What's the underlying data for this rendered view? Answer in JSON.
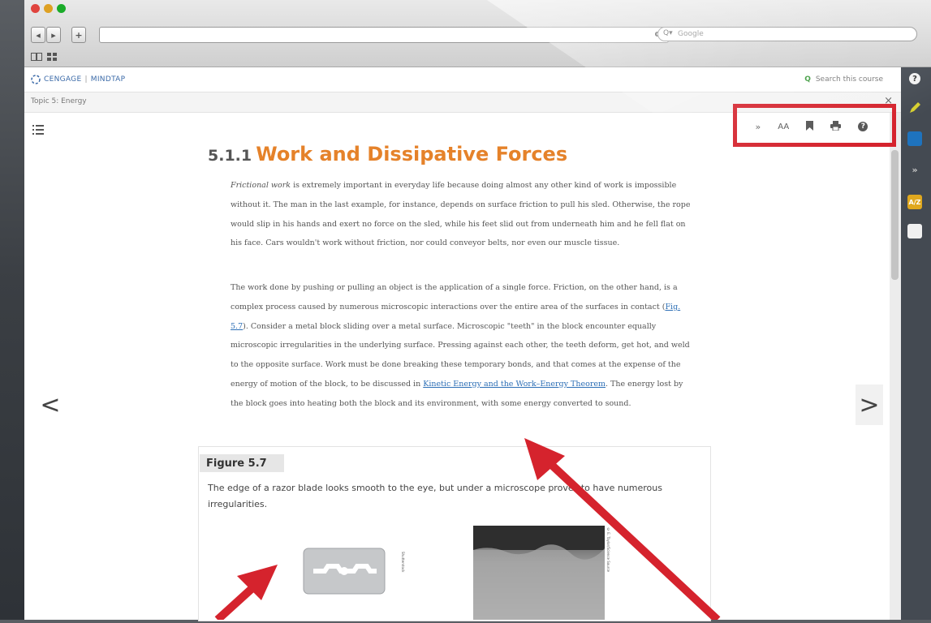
{
  "browser": {
    "nav_back": "◂",
    "nav_forward": "▸",
    "nav_add": "+",
    "reload": "c",
    "search_placeholder": "Google",
    "search_prefix": "Q▾"
  },
  "app": {
    "logo_brand": "CENGAGE",
    "logo_product": "MINDTAP",
    "search_label": "Search this course",
    "breadcrumb": "Topic 5: Energy",
    "close": "×"
  },
  "toolbar": {
    "highlight_label": "»",
    "font_size_label": "AA",
    "bookmark_label": "",
    "print_label": "",
    "help_label": "?"
  },
  "article": {
    "section_number": "5.1.1",
    "section_title": "Work and Dissipative Forces",
    "p1_italic": "Frictional work",
    "p1_rest": " is extremely important in everyday life because doing almost any other kind of work is impossible without it. The man in the last example, for instance, depends on surface friction to pull his sled. Otherwise, the rope would slip in his hands and exert no force on the sled, while his feet slid out from underneath him and he fell flat on his face. Cars wouldn't work without friction, nor could conveyor belts, nor even our muscle tissue.",
    "p2_before": "The work done by pushing or pulling an object is the application of a single force. Friction, on the other hand, is a complex process caused by numerous microscopic interactions over the entire area of the surfaces in contact (",
    "p2_link1": "Fig. 5.7",
    "p2_mid": "). Consider a metal block sliding over a metal surface. Microscopic \"teeth\" in the block encounter equally microscopic irregularities in the underlying surface. Pressing against each other, the teeth deform, get hot, and weld to the opposite surface. Work must be done breaking these temporary bonds, and that comes at the expense of the energy of motion of the block, to be discussed in ",
    "p2_link2": "Kinetic Energy and the Work–Energy Theorem",
    "p2_after": ". The energy lost by the block goes into heating both the block and its environment, with some energy converted to sound."
  },
  "figure": {
    "label": "Figure 5.7",
    "caption": "The edge of a razor blade looks smooth to the eye, but under a microscope proves to have numerous irregularities.",
    "credit1": "Shutterstock",
    "credit2": "© E. Taylor/Science Source"
  },
  "pager": {
    "prev": "<",
    "next": ">"
  },
  "colors": {
    "accent_orange": "#e5822a",
    "link_blue": "#2d6fb6",
    "annotation_red": "#d5232d"
  }
}
